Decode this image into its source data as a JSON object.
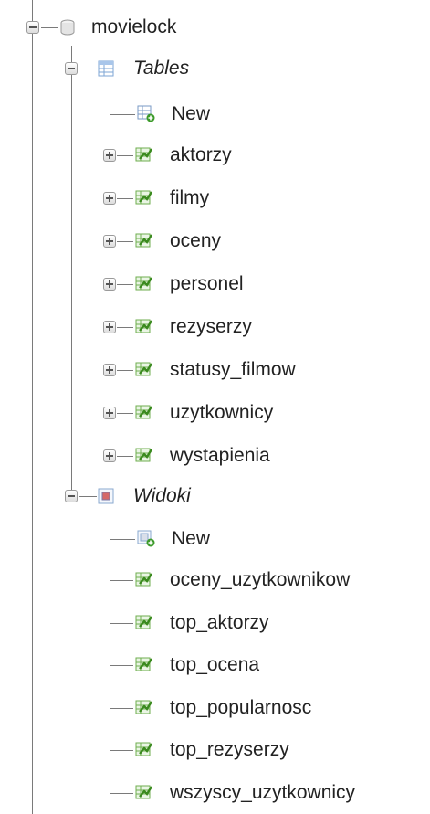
{
  "database": {
    "name": "movielock",
    "icon": "database-icon"
  },
  "tables_group": {
    "label": "Tables",
    "new_label": "New",
    "items": [
      "aktorzy",
      "filmy",
      "oceny",
      "personel",
      "rezyserzy",
      "statusy_filmow",
      "uzytkownicy",
      "wystapienia"
    ]
  },
  "views_group": {
    "label": "Widoki",
    "new_label": "New",
    "items": [
      "oceny_uzytkownikow",
      "top_aktorzy",
      "top_ocena",
      "top_popularnosc",
      "top_rezyserzy",
      "wszyscy_uzytkownicy"
    ]
  },
  "colors": {
    "line": "#7a7a7a",
    "table_icon": "#4a9a2a",
    "folder_icon": "#4f7fc4"
  }
}
